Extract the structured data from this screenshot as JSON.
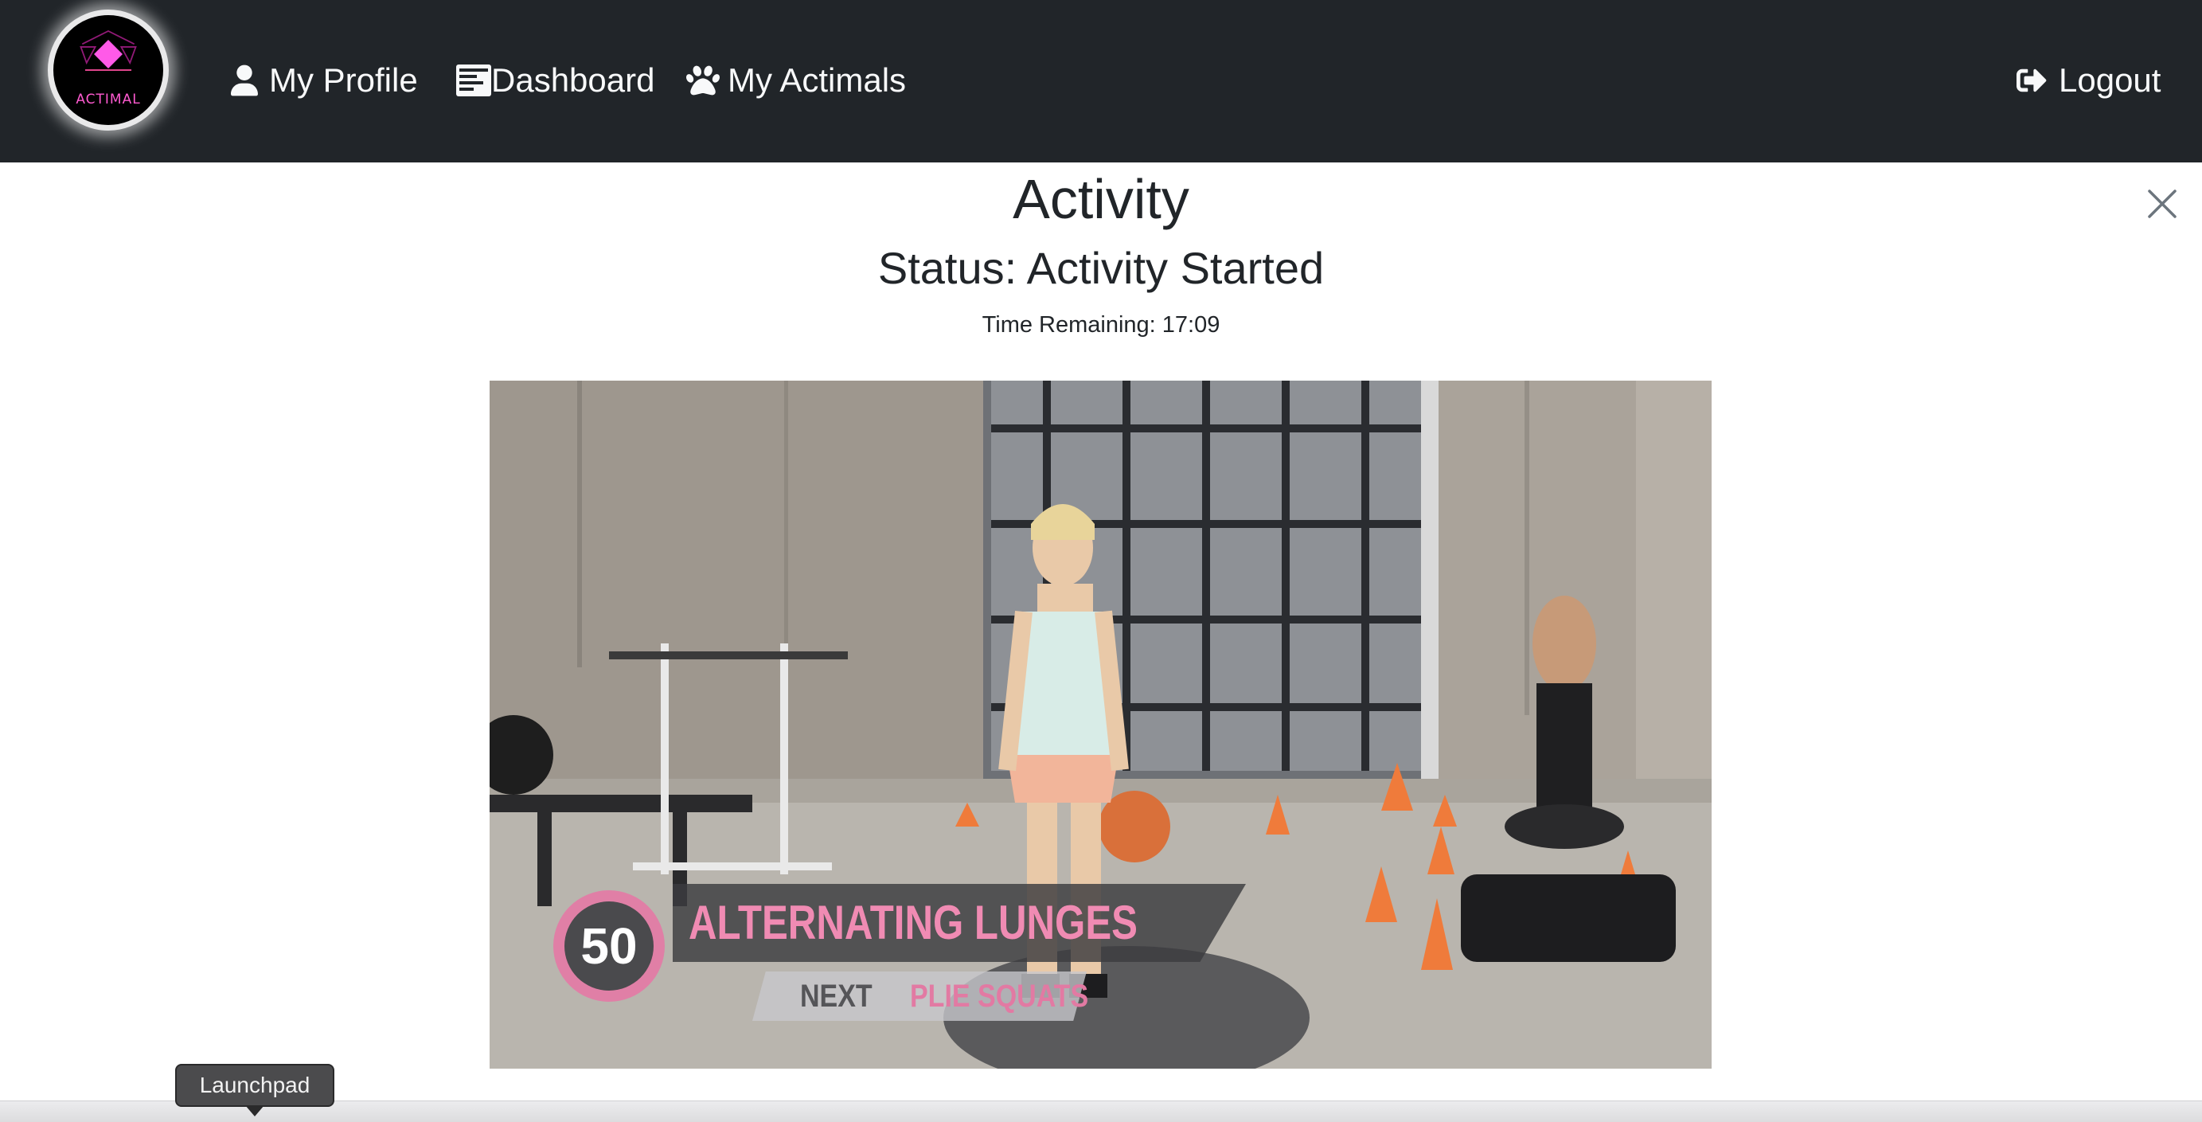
{
  "navbar": {
    "logo_text": "ACTIMAL",
    "items": [
      {
        "label": "My Profile",
        "icon": "user-icon"
      },
      {
        "label": "Dashboard",
        "icon": "dashboard-icon"
      },
      {
        "label": "My Actimals",
        "icon": "paw-icon"
      }
    ],
    "logout_label": "Logout",
    "logout_icon": "sign-out-icon",
    "background": "#212529"
  },
  "activity": {
    "title": "Activity",
    "status": "Status: Activity Started",
    "time_remaining": "Time Remaining: 17:09",
    "close_icon": "close-icon"
  },
  "video": {
    "rep_count": "50",
    "exercise": "ALTERNATING LUNGES",
    "next_label": "NEXT",
    "next_exercise": "PLIE SQUATS",
    "accent": "#e87fa8"
  },
  "dock": {
    "tooltip": "Launchpad"
  }
}
